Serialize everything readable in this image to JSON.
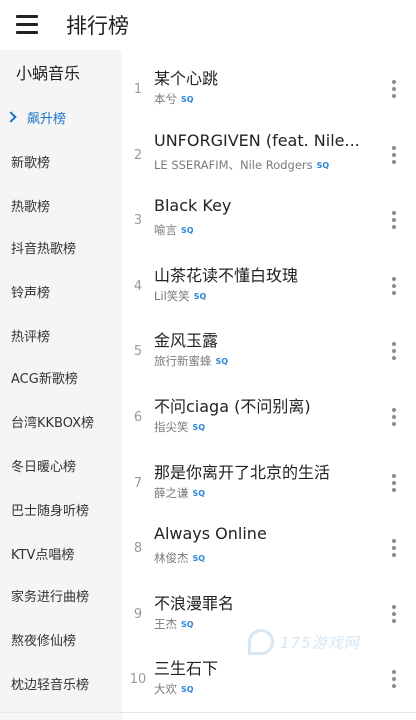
{
  "header": {
    "title": "排行榜"
  },
  "sidebar": {
    "brand": "小蜗音乐",
    "items": [
      {
        "label": "飙升榜",
        "active": true
      },
      {
        "label": "新歌榜"
      },
      {
        "label": "热歌榜"
      },
      {
        "label": "抖音热歌榜"
      },
      {
        "label": "铃声榜"
      },
      {
        "label": "热评榜"
      },
      {
        "label": "ACG新歌榜"
      },
      {
        "label": "台湾KKBOX榜"
      },
      {
        "label": "冬日暖心榜"
      },
      {
        "label": "巴士随身听榜"
      },
      {
        "label": "KTV点唱榜"
      },
      {
        "label": "家务进行曲榜"
      },
      {
        "label": "熬夜修仙榜"
      },
      {
        "label": "枕边轻音乐榜"
      }
    ]
  },
  "songs": [
    {
      "rank": "1",
      "title": "某个心跳",
      "artist": "本兮",
      "badge": "SQ"
    },
    {
      "rank": "2",
      "title": "UNFORGIVEN (feat. Nile...",
      "artist": "LE SSERAFIM、Nile Rodgers",
      "badge": "SQ"
    },
    {
      "rank": "3",
      "title": "Black Key",
      "artist": "喻言",
      "badge": "SQ"
    },
    {
      "rank": "4",
      "title": "山茶花读不懂白玫瑰",
      "artist": "Lil笑笑",
      "badge": "SQ"
    },
    {
      "rank": "5",
      "title": "金风玉露",
      "artist": "旅行新蜜蜂",
      "badge": "SQ"
    },
    {
      "rank": "6",
      "title": "不问ciaga (不问别离)",
      "artist": "指尖笑",
      "badge": "SQ"
    },
    {
      "rank": "7",
      "title": "那是你离开了北京的生活",
      "artist": "薛之谦",
      "badge": "SQ"
    },
    {
      "rank": "8",
      "title": "Always Online",
      "artist": "林俊杰",
      "badge": "SQ"
    },
    {
      "rank": "9",
      "title": "不浪漫罪名",
      "artist": "王杰",
      "badge": "SQ"
    },
    {
      "rank": "10",
      "title": "三生石下",
      "artist": "大欢",
      "badge": "SQ"
    }
  ],
  "watermark": {
    "text": "175游戏网"
  },
  "colors": {
    "accent": "#1a73c8",
    "sq_badge": "#2f86d6",
    "sidebar_bg": "#f5f5f5"
  }
}
